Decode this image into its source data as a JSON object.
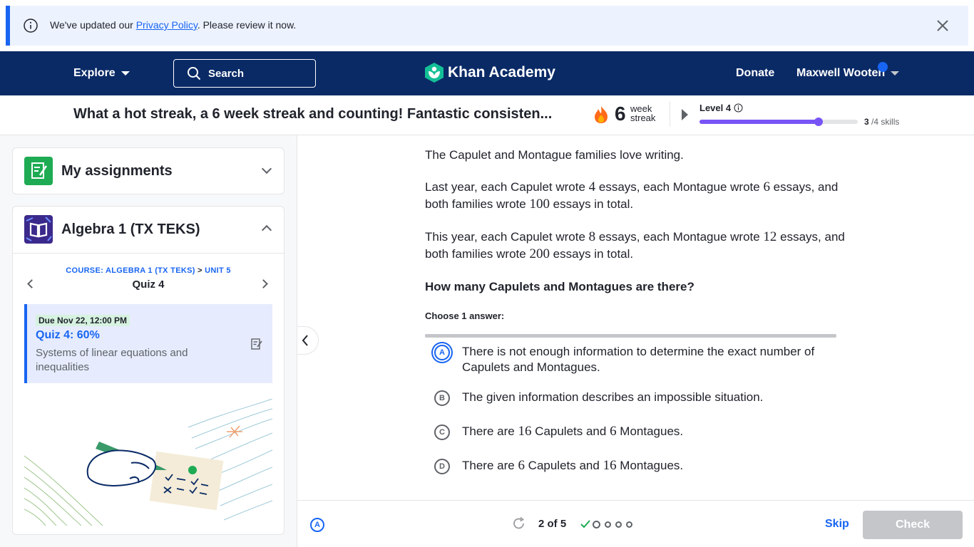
{
  "banner": {
    "text_before": "We've updated our ",
    "link": "Privacy Policy",
    "text_after": ". Please review it now."
  },
  "nav": {
    "explore": "Explore",
    "search": "Search",
    "logo": "Khan Academy",
    "donate": "Donate",
    "user": "Maxwell Wooten"
  },
  "streak": {
    "message": "What a hot streak, a 6 week streak and counting! Fantastic consisten...",
    "count": "6",
    "unit_line1": "week",
    "unit_line2": "streak",
    "level": "Level 4",
    "skills_done": "3",
    "skills_total": "/4 skills",
    "progress_fraction": 0.75
  },
  "sidebar": {
    "assignments_title": "My assignments",
    "course_title": "Algebra 1 (TX TEKS)",
    "breadcrumb_course": "COURSE: ALGEBRA 1 (TX TEKS)",
    "breadcrumb_sep": " > ",
    "breadcrumb_unit": "UNIT 5",
    "quiz_name": "Quiz 4",
    "assignment": {
      "due": "Due Nov 22, 12:00 PM",
      "title": "Quiz 4: 60%",
      "description": "Systems of linear equations and inequalities"
    }
  },
  "problem": {
    "intro": "The Capulet and Montague families love writing.",
    "p2": {
      "a": "Last year, each Capulet wrote ",
      "n1": "4",
      "b": " essays, each Montague wrote ",
      "n2": "6",
      "c": " essays, and both families wrote ",
      "n3": "100",
      "d": " essays in total."
    },
    "p3": {
      "a": "This year, each Capulet wrote ",
      "n1": "8",
      "b": " essays, each Montague wrote ",
      "n2": "12",
      "c": " essays, and both families wrote ",
      "n3": "200",
      "d": " essays in total."
    },
    "question": "How many Capulets and Montagues are there?",
    "choose": "Choose 1 answer:",
    "options": [
      {
        "letter": "A",
        "text": "There is not enough information to determine the exact number of Capulets and Montagues."
      },
      {
        "letter": "B",
        "text": "The given information describes an impossible situation."
      },
      {
        "letter": "C",
        "pre": "There are ",
        "n1": "16",
        "mid": " Capulets and ",
        "n2": "6",
        "post": " Montagues."
      },
      {
        "letter": "D",
        "pre": "There are ",
        "n1": "6",
        "mid": " Capulets and ",
        "n2": "16",
        "post": " Montagues."
      }
    ],
    "selected": "A"
  },
  "footer": {
    "a11y_letter": "A",
    "progress": "2 of 5",
    "skip": "Skip",
    "check": "Check"
  },
  "colors": {
    "navy": "#0a2a66",
    "blue": "#1865f2",
    "green": "#1fab54",
    "purple": "#7854f7"
  }
}
